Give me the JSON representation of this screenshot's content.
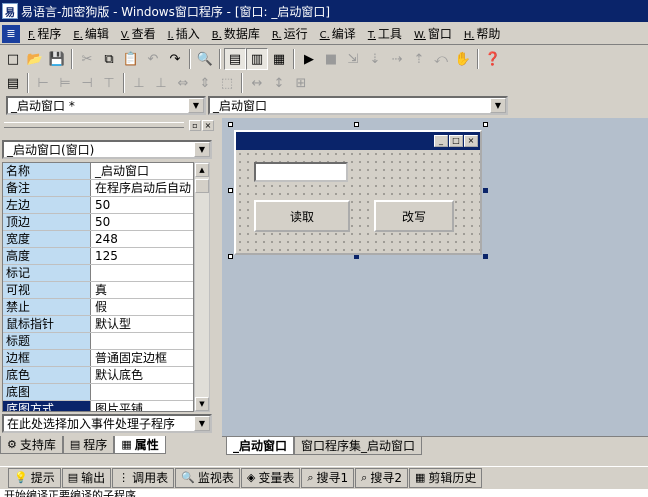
{
  "window": {
    "title": "易语言-加密狗版 - Windows窗口程序 - [窗口: _启动窗口]",
    "app_icon": "easy-language-icon"
  },
  "menu": [
    {
      "acc": "F.",
      "label": "程序"
    },
    {
      "acc": "E.",
      "label": "编辑"
    },
    {
      "acc": "V.",
      "label": "查看"
    },
    {
      "acc": "I.",
      "label": "插入"
    },
    {
      "acc": "B.",
      "label": "数据库"
    },
    {
      "acc": "R.",
      "label": "运行"
    },
    {
      "acc": "C.",
      "label": "编译"
    },
    {
      "acc": "T.",
      "label": "工具"
    },
    {
      "acc": "W.",
      "label": "窗口"
    },
    {
      "acc": "H.",
      "label": "帮助"
    }
  ],
  "toolbar1": {
    "new": "□",
    "open": "📂",
    "save": "💾",
    "cut": "✂",
    "copy": "⧉",
    "paste": "📋",
    "undo": "↶",
    "redo": "↷",
    "find": "🔍",
    "layout1": "▤",
    "layout2": "▥",
    "layout3": "▦",
    "run": "▶",
    "stop": "■",
    "step1": "⇲",
    "step2": "⇣",
    "step3": "⇢",
    "step4": "⇡",
    "step5": "⤺",
    "hand": "✋",
    "help": "❓"
  },
  "toolbar2": {
    "form": "▤",
    "align_left": "⊢",
    "align_center": "⊨",
    "align_right": "⊣",
    "align_top": "⊤",
    "align_middle": "⊥",
    "align_bottom": "⊥",
    "same_width": "⇔",
    "same_height": "⇕",
    "same_size": "⬚",
    "hspace": "↔",
    "vspace": "↕",
    "center_h": "⊞",
    "center_v": "⊟",
    "order": "▣"
  },
  "combos": {
    "form_selector": "_启动窗口 *",
    "object_selector": "_启动窗口"
  },
  "properties": {
    "object_combo": "_启动窗口(窗口)",
    "rows": [
      {
        "name": "名称",
        "value": "_启动窗口"
      },
      {
        "name": "备注",
        "value": "在程序启动后自动"
      },
      {
        "name": "左边",
        "value": "50"
      },
      {
        "name": "顶边",
        "value": "50"
      },
      {
        "name": "宽度",
        "value": "248"
      },
      {
        "name": "高度",
        "value": "125"
      },
      {
        "name": "标记",
        "value": ""
      },
      {
        "name": "可视",
        "value": "真"
      },
      {
        "name": "禁止",
        "value": "假"
      },
      {
        "name": "鼠标指针",
        "value": "默认型"
      },
      {
        "name": "标题",
        "value": ""
      },
      {
        "name": "边框",
        "value": "普通固定边框"
      },
      {
        "name": "底色",
        "value": "默认底色"
      },
      {
        "name": "底图",
        "value": ""
      },
      {
        "name": "底图方式",
        "value": "图片平铺"
      }
    ],
    "event_combo": "在此处选择加入事件处理子程序"
  },
  "left_tabs": [
    {
      "label": "支持库",
      "icon": "library-icon"
    },
    {
      "label": "程序",
      "icon": "program-icon"
    },
    {
      "label": "属性",
      "icon": "property-icon"
    }
  ],
  "designer": {
    "button_read": "读取",
    "button_write": "改写",
    "min": "_",
    "max": "□",
    "close": "×"
  },
  "canvas_tabs": [
    {
      "label": "_启动窗口"
    },
    {
      "label": "窗口程序集_启动窗口"
    }
  ],
  "output_tabs": [
    {
      "label": "提示",
      "icon": "hint-icon"
    },
    {
      "label": "输出",
      "icon": "output-icon"
    },
    {
      "label": "调用表",
      "icon": "call-table-icon"
    },
    {
      "label": "监视表",
      "icon": "watch-icon"
    },
    {
      "label": "变量表",
      "icon": "variable-icon"
    },
    {
      "label": "搜寻1",
      "icon": "search1-icon"
    },
    {
      "label": "搜寻2",
      "icon": "search2-icon"
    },
    {
      "label": "剪辑历史",
      "icon": "clip-history-icon"
    }
  ],
  "status": "开始编译正要编译的子程序"
}
